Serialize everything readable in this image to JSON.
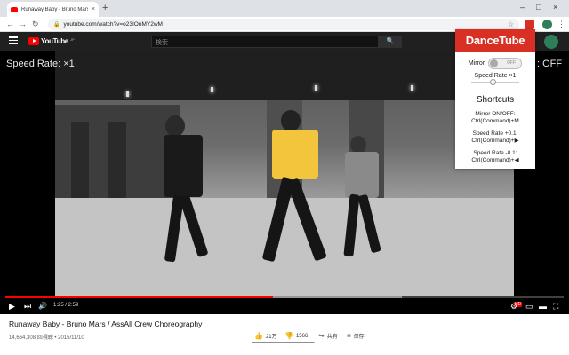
{
  "browser": {
    "tab_title": "Runaway Baby - Bruno Mars / ...",
    "tab_close": "×",
    "new_tab": "+",
    "window_controls": [
      "–",
      "□",
      "×"
    ],
    "url": "youtube.com/watch?v=o23IOnMY2wM",
    "nav": [
      "←",
      "→",
      "↻"
    ],
    "bookmark_icon": "star-icon",
    "menu_glyph": "⋮"
  },
  "youtube": {
    "logo_text": "YouTube",
    "logo_region": "JP",
    "search_placeholder": "検索",
    "search_button": "🔍"
  },
  "video": {
    "speed_overlay": "Speed Rate: ×1",
    "mirror_overlay": ": OFF",
    "current_time": "1:25 / 2:59",
    "progress_fraction": 0.48,
    "buffer_fraction": 0.71,
    "controls": {
      "play": "▶",
      "next": "⏭",
      "volume": "🔊",
      "hd": "HD",
      "settings": "⚙",
      "miniplayer": "▭",
      "theater": "▬",
      "fullscreen": "⛶"
    }
  },
  "below": {
    "title": "Runaway Baby - Bruno Mars / AssAll Crew Choreography",
    "meta": "14,664,308 回視聴 • 2015/11/10",
    "likes": "21万",
    "dislikes": "1566",
    "share": "共有",
    "save": "保存",
    "more": "…",
    "like_ratio": 0.99
  },
  "popup": {
    "title": "DanceTube",
    "mirror_label": "Mirror",
    "mirror_state": "OFF",
    "speed_label": "Speed Rate ×1",
    "speed_fraction": 0.45,
    "shortcuts_heading": "Shortcuts",
    "shortcuts": [
      {
        "name": "Mirror ON/OFF:",
        "keys": "Ctrl(Command)+M"
      },
      {
        "name": "Speed Rate +0.1:",
        "keys": "Ctrl(Command)+▶"
      },
      {
        "name": "Speed Rate -0.1:",
        "keys": "Ctrl(Command)+◀"
      }
    ]
  },
  "colors": {
    "accent": "#d93025",
    "youtube_red": "#ff0000",
    "header_dark": "#202020"
  }
}
